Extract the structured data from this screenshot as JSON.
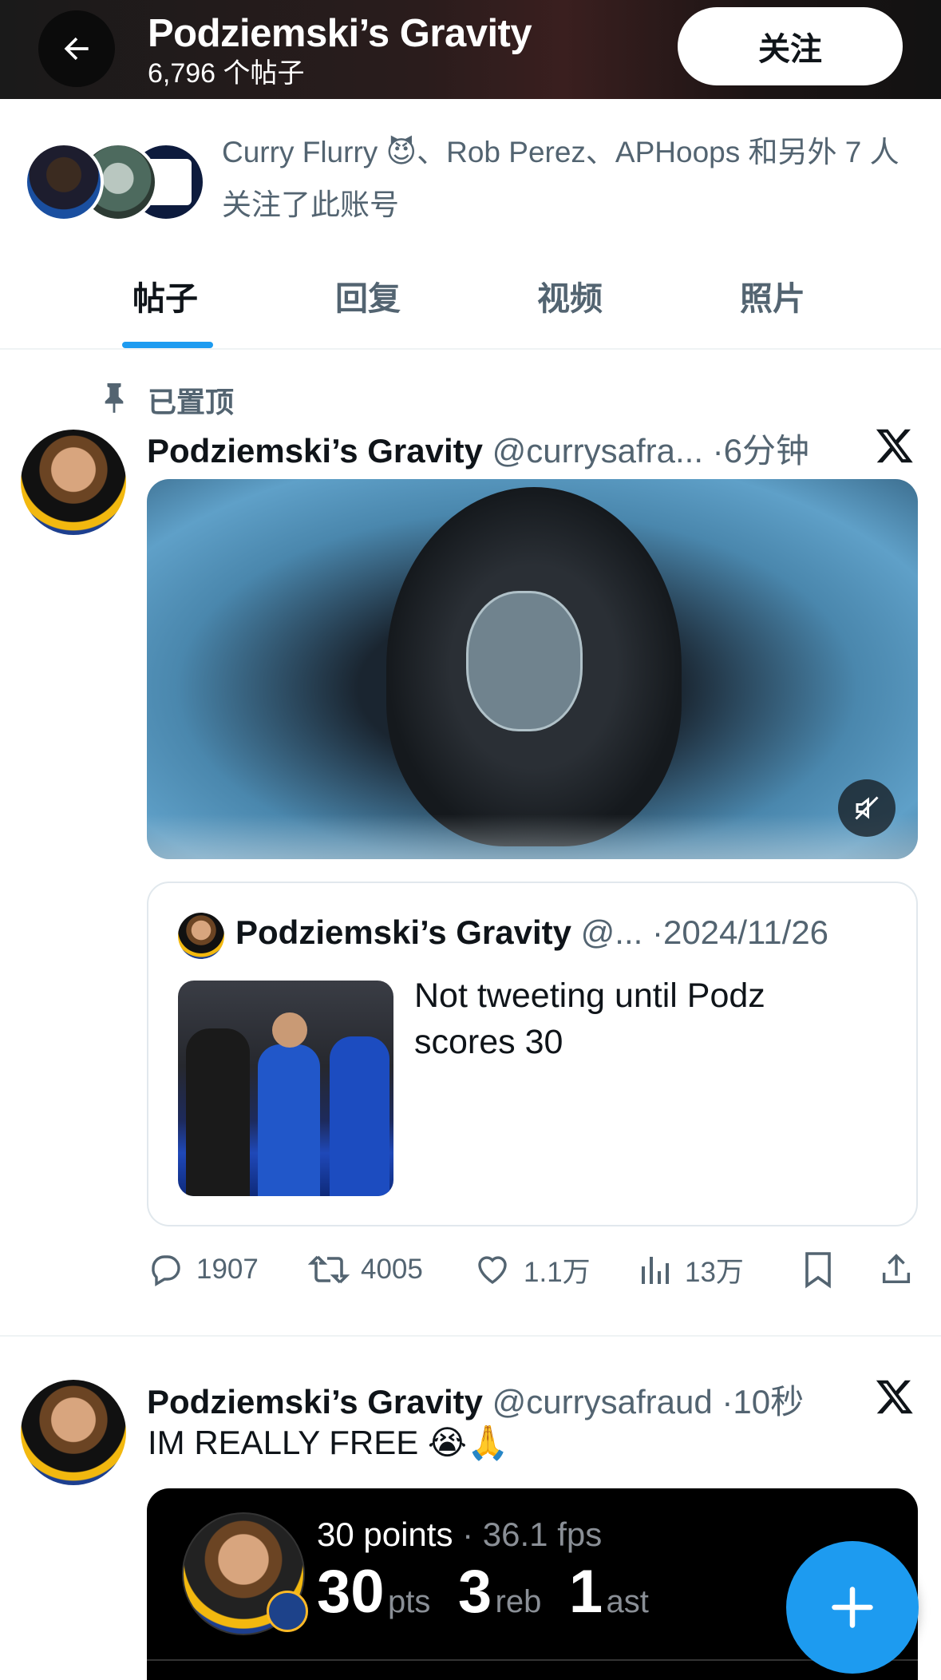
{
  "header": {
    "title": "Podziemski’s Gravity",
    "post_count": "6,796 个帖子",
    "follow_label": "关注"
  },
  "followers": {
    "text": "Curry Flurry 😈、Rob Perez、APHoops 和另外 7 人关注了此账号"
  },
  "tabs": [
    {
      "label": "帖子",
      "active": true
    },
    {
      "label": "回复",
      "active": false
    },
    {
      "label": "视频",
      "active": false
    },
    {
      "label": "照片",
      "active": false
    }
  ],
  "pinned_label": "已置顶",
  "posts": [
    {
      "name": "Podziemski’s Gravity",
      "handle": "@currysafra...",
      "time": "·6分钟",
      "quote": {
        "name": "Podziemski’s Gravity",
        "handle": "@...",
        "date": "·2024/11/26",
        "text": "Not tweeting until Podz scores 30"
      },
      "actions": {
        "replies": "1907",
        "reposts": "4005",
        "likes": "1.1万",
        "views": "13万"
      }
    },
    {
      "name": "Podziemski’s Gravity",
      "handle": "@currysafraud",
      "time": "·10秒",
      "text": "IM REALLY FREE 😭🙏",
      "stat_card": {
        "title": "30 points",
        "fps": "· 36.1 fps",
        "pts_num": "30",
        "pts_label": "pts",
        "reb_num": "3",
        "reb_label": "reb",
        "ast_num": "1",
        "ast_label": "ast"
      }
    }
  ],
  "colors": {
    "accent": "#1d9bf0",
    "text_primary": "#0f1419",
    "text_secondary": "#536471",
    "divider": "#eff3f4"
  }
}
